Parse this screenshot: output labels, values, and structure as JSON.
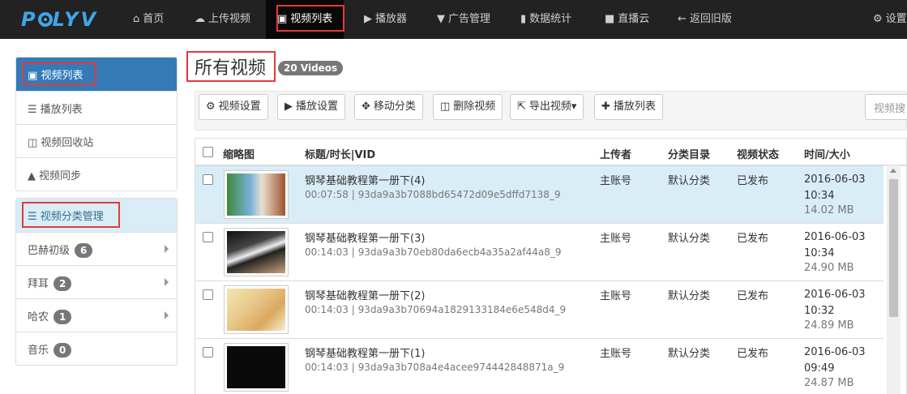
{
  "brand": {
    "logo": "POLYV"
  },
  "nav": {
    "items": [
      {
        "label": "首页",
        "icon": "home-icon"
      },
      {
        "label": "上传视频",
        "icon": "upload-icon"
      },
      {
        "label": "视频列表",
        "icon": "film-icon",
        "active": true
      },
      {
        "label": "播放器",
        "icon": "play-circle-icon"
      },
      {
        "label": "广告管理",
        "icon": "filter-icon"
      },
      {
        "label": "数据统计",
        "icon": "bar-chart-icon"
      },
      {
        "label": "直播云",
        "icon": "video-camera-icon"
      },
      {
        "label": "返回旧版",
        "icon": "arrow-left-icon"
      }
    ],
    "settings": "设置"
  },
  "sidebar": {
    "head": "视频列表",
    "items": [
      "播放列表",
      "视频回收站",
      "视频同步"
    ],
    "category_head": "视频分类管理",
    "categories": [
      {
        "label": "巴赫初级",
        "count": "6"
      },
      {
        "label": "拜耳",
        "count": "2"
      },
      {
        "label": "哈农",
        "count": "1"
      },
      {
        "label": "音乐",
        "count": "0"
      }
    ]
  },
  "main": {
    "title": "所有视频",
    "count_badge": "20 Videos",
    "toolbar": {
      "buttons": [
        "视频设置",
        "播放设置",
        "移动分类",
        "删除视频",
        "导出视频",
        "播放列表"
      ],
      "search_placeholder": "视频搜"
    },
    "table": {
      "headers": [
        "缩略图",
        "标题/时长|VID",
        "上传者",
        "分类目录",
        "视频状态",
        "时间/大小"
      ],
      "rows": [
        {
          "title": "钢琴基础教程第一册下(4)",
          "sub": "00:07:58 | 93da9a3b7088bd65472d09e5dffd7138_9",
          "uploader": "主账号",
          "category": "默认分类",
          "status": "已发布",
          "date": "2016-06-03",
          "time": "10:34",
          "size": "14.02 MB"
        },
        {
          "title": "钢琴基础教程第一册下(3)",
          "sub": "00:14:03 | 93da9a3b70eb80da6ecb4a35a2af44a8_9",
          "uploader": "主账号",
          "category": "默认分类",
          "status": "已发布",
          "date": "2016-06-03",
          "time": "10:34",
          "size": "24.90 MB"
        },
        {
          "title": "钢琴基础教程第一册下(2)",
          "sub": "00:14:03 | 93da9a3b70694a1829133184e6e548d4_9",
          "uploader": "主账号",
          "category": "默认分类",
          "status": "已发布",
          "date": "2016-06-03",
          "time": "10:32",
          "size": "24.89 MB"
        },
        {
          "title": "钢琴基础教程第一册下(1)",
          "sub": "00:14:03 | 93da9a3b708a4e4acee974442848871a_9",
          "uploader": "主账号",
          "category": "默认分类",
          "status": "已发布",
          "date": "2016-06-03",
          "time": "09:49",
          "size": "24.87 MB"
        }
      ]
    }
  },
  "colors": {
    "nav_bg": "#222222",
    "primary": "#337ab7",
    "highlight": "#e4393c",
    "selected_row": "#d9edf7"
  }
}
